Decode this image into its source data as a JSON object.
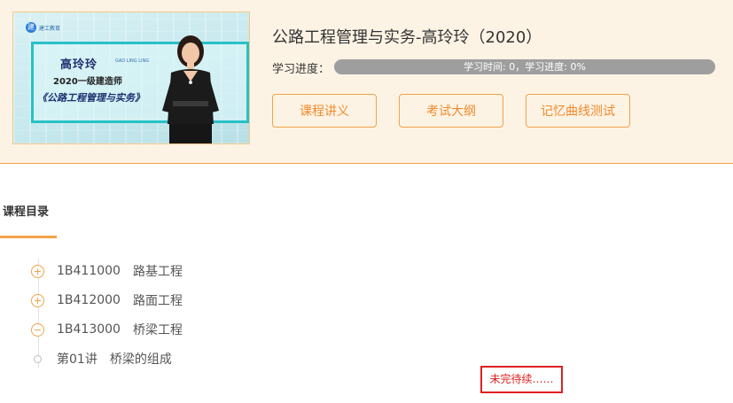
{
  "course": {
    "title": "公路工程管理与实务-高玲玲（2020）",
    "thumbnail": {
      "logo_text": "建工教育",
      "teacher_name": "高玲玲",
      "teacher_pinyin": "GAO LING LING",
      "line2": "2020一级建造师",
      "line3": "《公路工程管理与实务》"
    }
  },
  "progress": {
    "label": "学习进度：",
    "text": "学习时间: 0，学习进度: 0%",
    "percent": 0
  },
  "buttons": {
    "handouts": "课程讲义",
    "syllabus": "考试大纲",
    "memory_test": "记忆曲线测试"
  },
  "catalog": {
    "title": "课程目录",
    "items": [
      {
        "code": "1B411000",
        "name": "路基工程",
        "state": "collapsed"
      },
      {
        "code": "1B412000",
        "name": "路面工程",
        "state": "collapsed"
      },
      {
        "code": "1B413000",
        "name": "桥梁工程",
        "state": "expanded"
      }
    ],
    "leaf": {
      "code": "第01讲",
      "name": "桥梁的组成"
    }
  },
  "note": "未完待续……",
  "colors": {
    "accent": "#f0a34a",
    "header_bg": "#fdf3e4",
    "progress_track": "#9e9e9e",
    "note_red": "#e02020"
  }
}
